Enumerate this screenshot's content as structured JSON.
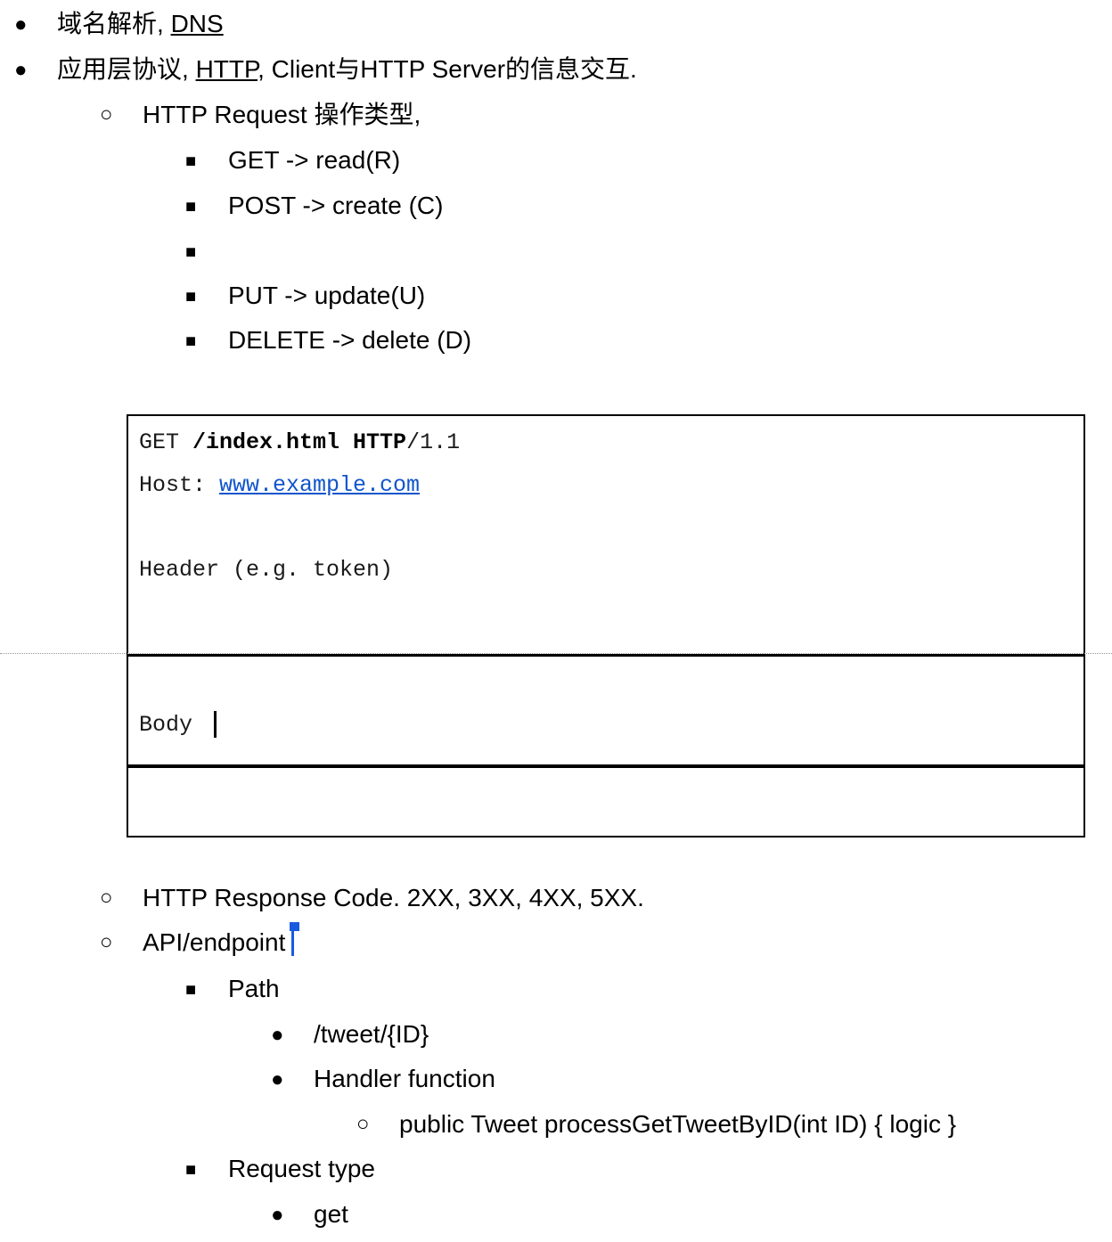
{
  "items": {
    "dns_prefix": "域名解析, ",
    "dns_link": "DNS",
    "http_prefix": "应用层协议, ",
    "http_link": "HTTP",
    "http_suffix": ", Client与HTTP Server的信息交互.",
    "request_types": "HTTP Request 操作类型,",
    "get": "GET -> read(R)",
    "post": "POST -> create (C)",
    "put": "PUT -> update(U)",
    "delete": "DELETE -> delete (D)",
    "response_code": "HTTP Response Code. 2XX, 3XX, 4XX, 5XX.",
    "api_endpoint": "API/endpoint",
    "path": "Path",
    "tweet_path": "/tweet/{ID}",
    "handler": "Handler function",
    "handler_sig": "public Tweet processGetTweetByID(int ID) { logic }",
    "request_type": "Request type",
    "get_lower": "get"
  },
  "code_box": {
    "line1_a": "GET ",
    "line1_b": "/index.html HTTP",
    "line1_c": "/1.1",
    "host_label": "Host: ",
    "host_link": "www.example.com",
    "header": "Header (e.g. token)",
    "body": "Body "
  },
  "glyphs": {
    "disc": "●",
    "circle": "○",
    "square": "■"
  },
  "colors": {
    "link": "#1155cc",
    "caret_selection": "#1a5ae0"
  }
}
